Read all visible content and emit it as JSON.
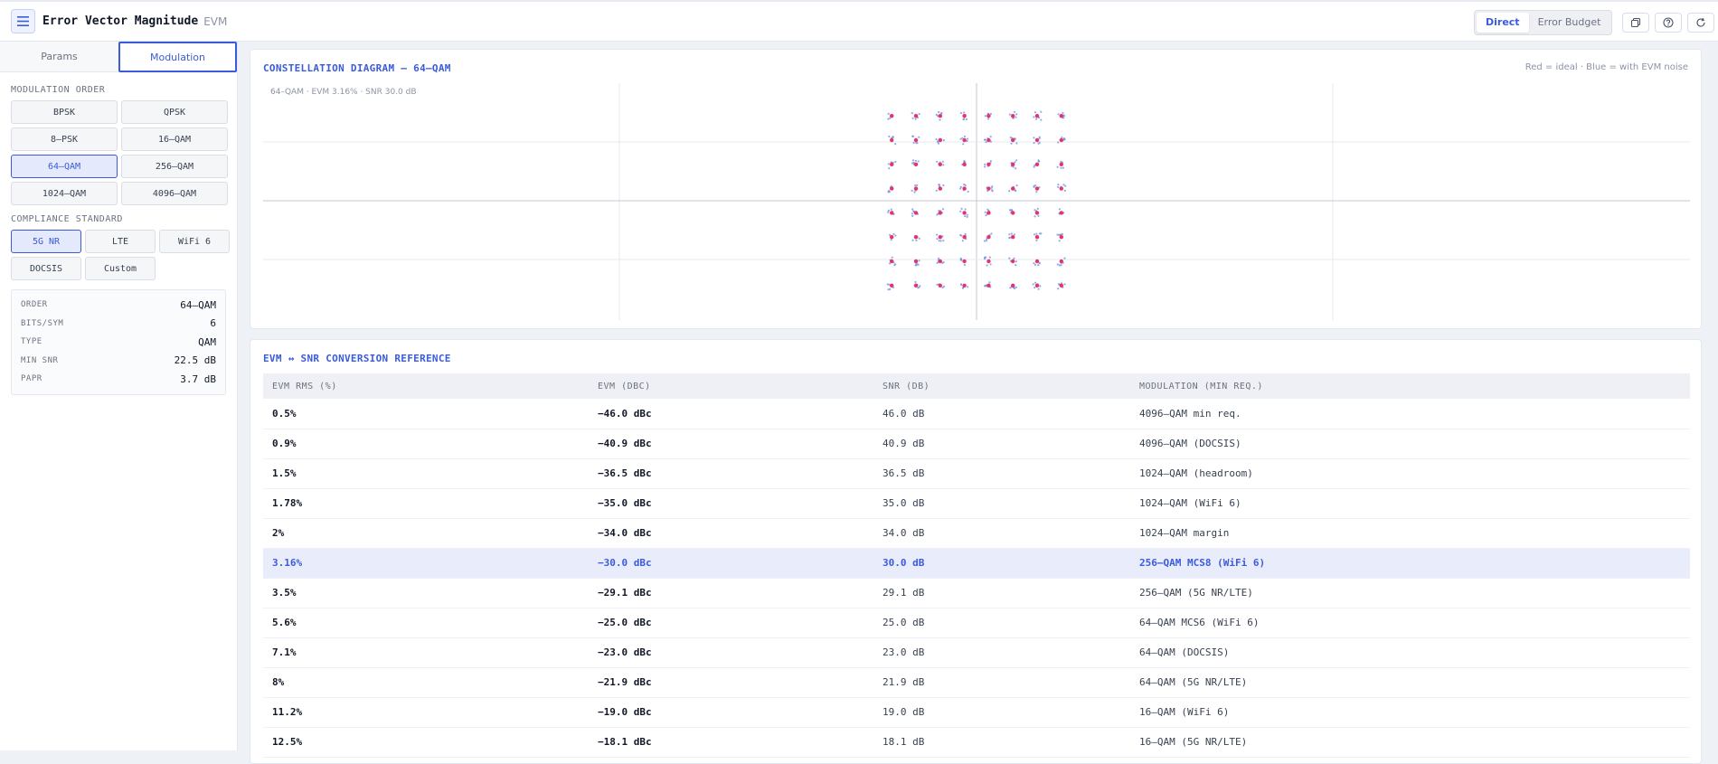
{
  "app": {
    "title": "Error Vector Magnitude",
    "subtitle": "EVM"
  },
  "header": {
    "modes": [
      {
        "label": "Direct",
        "active": true
      },
      {
        "label": "Error Budget",
        "active": false
      }
    ],
    "icons": [
      "copy-icon",
      "help-icon",
      "refresh-icon"
    ]
  },
  "sidebar": {
    "tabs": [
      {
        "label": "Params",
        "active": false
      },
      {
        "label": "Modulation",
        "active": true
      }
    ],
    "modulation_label": "MODULATION ORDER",
    "modulations": [
      {
        "label": "BPSK",
        "active": false
      },
      {
        "label": "QPSK",
        "active": false
      },
      {
        "label": "8–PSK",
        "active": false
      },
      {
        "label": "16–QAM",
        "active": false
      },
      {
        "label": "64–QAM",
        "active": true
      },
      {
        "label": "256–QAM",
        "active": false
      },
      {
        "label": "1024–QAM",
        "active": false
      },
      {
        "label": "4096–QAM",
        "active": false
      }
    ],
    "standard_label": "COMPLIANCE STANDARD",
    "standards": [
      {
        "label": "5G NR",
        "active": true
      },
      {
        "label": "LTE",
        "active": false
      },
      {
        "label": "WiFi 6",
        "active": false
      },
      {
        "label": "DOCSIS",
        "active": false
      },
      {
        "label": "Custom",
        "active": false
      }
    ],
    "info": [
      {
        "key": "ORDER",
        "value": "64–QAM"
      },
      {
        "key": "BITS/SYM",
        "value": "6"
      },
      {
        "key": "TYPE",
        "value": "QAM"
      },
      {
        "key": "MIN SNR",
        "value": "22.5 dB"
      },
      {
        "key": "PAPR",
        "value": "3.7 dB"
      }
    ]
  },
  "constellation": {
    "title": "CONSTELLATION DIAGRAM — 64–QAM",
    "legend_note": "Red = ideal · Blue = with EVM noise",
    "caption": "64–QAM · EVM 3.16% · SNR 30.0 dB",
    "grid_size": 8,
    "ideal_color": "#e8336a",
    "noise_color": "#6d8fe0"
  },
  "reference": {
    "title": "EVM ↔ SNR CONVERSION REFERENCE",
    "columns": [
      "EVM RMS (%)",
      "EVM (DBC)",
      "SNR (DB)",
      "MODULATION (MIN REQ.)"
    ],
    "highlight_index": 5,
    "rows": [
      [
        "0.5%",
        "−46.0 dBc",
        "46.0 dB",
        "4096–QAM min req."
      ],
      [
        "0.9%",
        "−40.9 dBc",
        "40.9 dB",
        "4096–QAM (DOCSIS)"
      ],
      [
        "1.5%",
        "−36.5 dBc",
        "36.5 dB",
        "1024–QAM (headroom)"
      ],
      [
        "1.78%",
        "−35.0 dBc",
        "35.0 dB",
        "1024–QAM (WiFi 6)"
      ],
      [
        "2%",
        "−34.0 dBc",
        "34.0 dB",
        "1024–QAM margin"
      ],
      [
        "3.16%",
        "−30.0 dBc",
        "30.0 dB",
        "256–QAM MCS8 (WiFi 6)"
      ],
      [
        "3.5%",
        "−29.1 dBc",
        "29.1 dB",
        "256–QAM (5G NR/LTE)"
      ],
      [
        "5.6%",
        "−25.0 dBc",
        "25.0 dB",
        "64–QAM MCS6 (WiFi 6)"
      ],
      [
        "7.1%",
        "−23.0 dBc",
        "23.0 dB",
        "64–QAM (DOCSIS)"
      ],
      [
        "8%",
        "−21.9 dBc",
        "21.9 dB",
        "64–QAM (5G NR/LTE)"
      ],
      [
        "11.2%",
        "−19.0 dBc",
        "19.0 dB",
        "16–QAM (WiFi 6)"
      ],
      [
        "12.5%",
        "−18.1 dBc",
        "18.1 dB",
        "16–QAM (5G NR/LTE)"
      ]
    ]
  }
}
